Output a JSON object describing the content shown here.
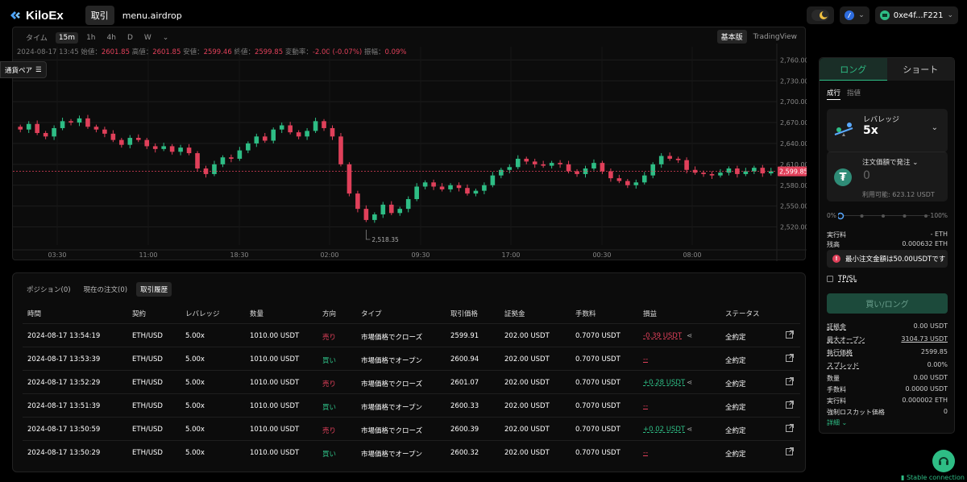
{
  "header": {
    "logo_text": "KiloEx",
    "nav_trade": "取引",
    "nav_airdrop": "menu.airdrop",
    "wallet_address": "0xe4f...F221",
    "icons": [
      "moon-icon",
      "network-icon",
      "wallet-icon",
      "chevron-down-icon"
    ]
  },
  "chart": {
    "timeframes": [
      "タイム",
      "15m",
      "1h",
      "4h",
      "D",
      "W"
    ],
    "active_timeframe": "15m",
    "view_basic": "基本版",
    "view_tradingview": "TradingView",
    "ohlc": {
      "datetime": "2024-08-17 13:45",
      "open_label": "始値：",
      "open": "2601.85",
      "high_label": "高値：",
      "high": "2601.85",
      "low_label": "安値：",
      "low": "2599.46",
      "close_label": "終値：",
      "close": "2599.85",
      "change_label": "変動率：",
      "change": "-2.00 (-0.07%)",
      "amp_label": "振幅：",
      "amp": "0.09%"
    },
    "pair_button": "通貨ペア",
    "current_price_label": "2,599.85",
    "min_label": "2,518.35"
  },
  "chart_data": {
    "type": "candlestick",
    "y_ticks": [
      "2,760.00",
      "2,730.00",
      "2,700.00",
      "2,670.00",
      "2,640.00",
      "2,610.00",
      "2,580.00",
      "2,550.00",
      "2,520.00"
    ],
    "y_tick_values": [
      2760,
      2730,
      2700,
      2670,
      2640,
      2610,
      2580,
      2550,
      2520
    ],
    "x_ticks": [
      "03:30",
      "11:00",
      "18:30",
      "02:00",
      "09:30",
      "17:00",
      "00:30",
      "08:00"
    ],
    "ylim": [
      2494,
      2772
    ],
    "current_price": 2599.85,
    "min_price": 2518.35,
    "close_series": [
      2660,
      2668,
      2655,
      2650,
      2662,
      2672,
      2670,
      2676,
      2664,
      2660,
      2654,
      2645,
      2638,
      2648,
      2645,
      2636,
      2632,
      2636,
      2628,
      2634,
      2626,
      2604,
      2596,
      2610,
      2620,
      2618,
      2630,
      2640,
      2650,
      2644,
      2660,
      2666,
      2656,
      2650,
      2658,
      2672,
      2662,
      2650,
      2610,
      2568,
      2546,
      2530,
      2538,
      2552,
      2540,
      2546,
      2560,
      2578,
      2584,
      2578,
      2574,
      2580,
      2576,
      2568,
      2572,
      2580,
      2594,
      2602,
      2606,
      2618,
      2614,
      2610,
      2608,
      2612,
      2610,
      2600,
      2596,
      2604,
      2612,
      2600,
      2590,
      2586,
      2580,
      2584,
      2594,
      2610,
      2622,
      2618,
      2616,
      2602,
      2598,
      2596,
      2594,
      2598,
      2604,
      2596,
      2600,
      2605,
      2597,
      2600
    ]
  },
  "positions": {
    "tabs": [
      "ポジション(0)",
      "現在の注文(0)",
      "取引履歴"
    ],
    "active_tab": "取引履歴",
    "columns": [
      "時間",
      "契約",
      "レバレッジ",
      "数量",
      "方向",
      "タイプ",
      "取引価格",
      "証拠金",
      "手数料",
      "損益",
      "ステータス"
    ],
    "rows": [
      {
        "time": "2024-08-17 13:54:19",
        "contract": "ETH/USD",
        "leverage": "5.00x",
        "qty": "1010.00 USDT",
        "side": "売り",
        "type": "市場価格でクローズ",
        "price": "2599.91",
        "margin": "202.00 USDT",
        "fee": "0.7070 USDT",
        "pnl": "-0.39 USDT",
        "status": "全約定"
      },
      {
        "time": "2024-08-17 13:53:39",
        "contract": "ETH/USD",
        "leverage": "5.00x",
        "qty": "1010.00 USDT",
        "side": "買い",
        "type": "市場価格でオープン",
        "price": "2600.94",
        "margin": "202.00 USDT",
        "fee": "0.7070 USDT",
        "pnl": "--",
        "status": "全約定"
      },
      {
        "time": "2024-08-17 13:52:29",
        "contract": "ETH/USD",
        "leverage": "5.00x",
        "qty": "1010.00 USDT",
        "side": "売り",
        "type": "市場価格でクローズ",
        "price": "2601.07",
        "margin": "202.00 USDT",
        "fee": "0.7070 USDT",
        "pnl": "+0.28 USDT",
        "status": "全約定"
      },
      {
        "time": "2024-08-17 13:51:39",
        "contract": "ETH/USD",
        "leverage": "5.00x",
        "qty": "1010.00 USDT",
        "side": "買い",
        "type": "市場価格でオープン",
        "price": "2600.33",
        "margin": "202.00 USDT",
        "fee": "0.7070 USDT",
        "pnl": "--",
        "status": "全約定"
      },
      {
        "time": "2024-08-17 13:50:59",
        "contract": "ETH/USD",
        "leverage": "5.00x",
        "qty": "1010.00 USDT",
        "side": "売り",
        "type": "市場価格でクローズ",
        "price": "2600.39",
        "margin": "202.00 USDT",
        "fee": "0.7070 USDT",
        "pnl": "+0.02 USDT",
        "status": "全約定"
      },
      {
        "time": "2024-08-17 13:50:29",
        "contract": "ETH/USD",
        "leverage": "5.00x",
        "qty": "1010.00 USDT",
        "side": "買い",
        "type": "市場価格でオープン",
        "price": "2600.32",
        "margin": "202.00 USDT",
        "fee": "0.7070 USDT",
        "pnl": "--",
        "status": "全約定"
      }
    ]
  },
  "order_panel": {
    "long_tab": "ロング",
    "short_tab": "ショート",
    "market": "成行",
    "limit": "指値",
    "leverage_label": "レバレッジ",
    "leverage_value": "5x",
    "amount_label": "注文価額で発注",
    "amount_value": "0",
    "available": "利用可能: 623.12 USDT",
    "slider_min": "0%",
    "slider_max": "100%",
    "slider_value": 0,
    "exec_fee_label": "実行料",
    "exec_fee_value": "- ETH",
    "balance_label": "残高",
    "balance_value": "0.000632 ETH",
    "warning": "最小注文金額は50.00USDTです",
    "tpsl": "TP/SL",
    "buy_button": "買い/ロング",
    "margin_label": "証拠金",
    "margin_value": "0.00 USDT",
    "max_open_label": "最大オープン",
    "max_open_value": "3104.73 USDT",
    "exec_price_label": "執行価格",
    "exec_price_value": "2599.85",
    "spread_label": "スプレッド",
    "spread_value": "0.00%",
    "qty_label": "数量",
    "qty_value": "0.00 USDT",
    "fee_label": "手数料",
    "fee_value": "0.0000 USDT",
    "exec_fee2_label": "実行料",
    "exec_fee2_value": "0.000002 ETH",
    "liq_label": "強制ロスカット価格",
    "liq_value": "0",
    "details": "詳細"
  },
  "status": {
    "connection": "Stable connection"
  },
  "colors": {
    "up": "#2ebd85",
    "down": "#e0405a"
  }
}
